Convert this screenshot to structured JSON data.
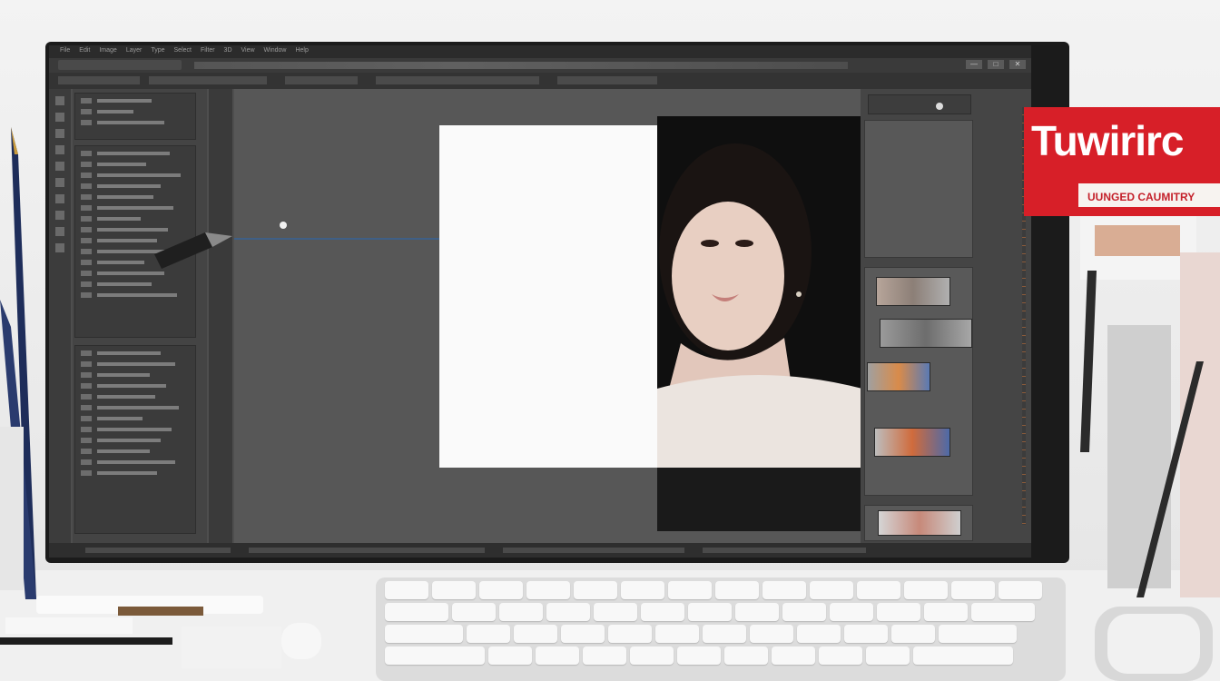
{
  "app": {
    "menu": [
      "File",
      "Edit",
      "Image",
      "Layer",
      "Type",
      "Select",
      "Filter",
      "3D",
      "View",
      "Window",
      "Help"
    ],
    "window_controls": [
      "—",
      "□",
      "✕"
    ]
  },
  "document": {
    "title": ""
  },
  "properties": {
    "label": ""
  },
  "sign": {
    "title": "Tuwirirc",
    "subtitle": "UUNGED CAUMITRY"
  },
  "photo": {
    "caption": ""
  },
  "colors": {
    "accent_blue": "#3f5f86",
    "sign_red": "#d71f28"
  },
  "icons": [
    "pen-tool-icon",
    "brush-icon",
    "eyedropper-icon"
  ]
}
